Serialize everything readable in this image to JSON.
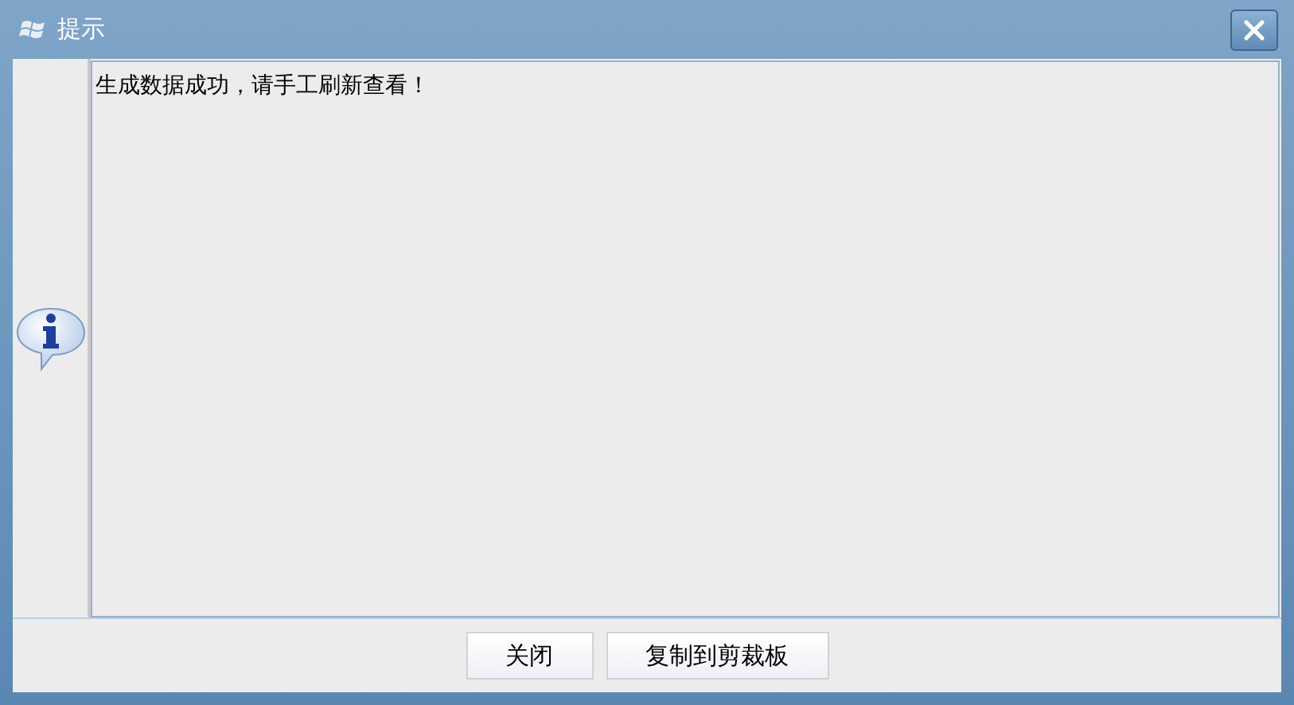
{
  "window": {
    "title": "提示"
  },
  "message": "生成数据成功，请手工刷新查看！",
  "buttons": [
    "关闭",
    "复制到剪裁板"
  ]
}
